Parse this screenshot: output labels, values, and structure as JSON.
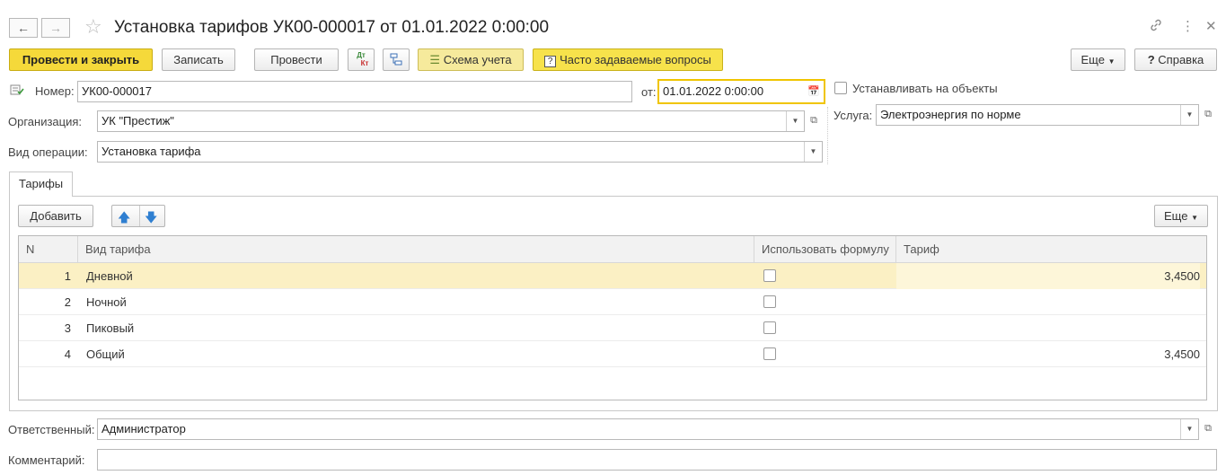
{
  "window": {
    "title": "Установка тарифов УК00-000017 от 01.01.2022 0:00:00",
    "back_icon": "arrow-left",
    "forward_icon": "arrow-right",
    "favorite_icon": "star-outline",
    "link_icon": "link",
    "menu_icon": "more-vertical",
    "close_icon": "close"
  },
  "toolbar": {
    "post_close_label": "Провести и закрыть",
    "save_label": "Записать",
    "post_label": "Провести",
    "dtkt_label_top": "Дт",
    "dtkt_label_bottom": "Кт",
    "scheme_label": "Схема учета",
    "faq_label": "Часто задаваемые вопросы",
    "faq_icon_glyph": "?",
    "more_label": "Еще",
    "help_label": "Справка",
    "help_icon_glyph": "?"
  },
  "form": {
    "number_label": "Номер:",
    "number_value": "УК00-000017",
    "date_label": "от:",
    "date_value": "01.01.2022  0:00:00",
    "organization_label": "Организация:",
    "organization_value": "УК \"Престиж\"",
    "operation_label": "Вид операции:",
    "operation_value": "Установка тарифа",
    "set_on_objects_label": "Устанавливать на объекты",
    "service_label": "Услуга:",
    "service_value": "Электроэнергия по норме",
    "responsible_label": "Ответственный:",
    "responsible_value": "Администратор",
    "comment_label": "Комментарий:",
    "comment_value": ""
  },
  "tabs": [
    {
      "label": "Тарифы",
      "active": true
    }
  ],
  "table_toolbar": {
    "add_label": "Добавить",
    "more_label": "Еще"
  },
  "table": {
    "columns": [
      "N",
      "Вид тарифа",
      "Использовать формулу",
      "Тариф"
    ],
    "rows": [
      {
        "n": "1",
        "name": "Дневной",
        "formula": false,
        "tariff": "3,4500"
      },
      {
        "n": "2",
        "name": "Ночной",
        "formula": false,
        "tariff": ""
      },
      {
        "n": "3",
        "name": "Пиковый",
        "formula": false,
        "tariff": ""
      },
      {
        "n": "4",
        "name": "Общий",
        "formula": false,
        "tariff": "3,4500"
      }
    ]
  },
  "colors": {
    "primary_button": "#f5d93a",
    "selected_row": "#fbf0c4",
    "focus_border": "#f0c500",
    "arrow_blue": "#2f7fd1"
  }
}
